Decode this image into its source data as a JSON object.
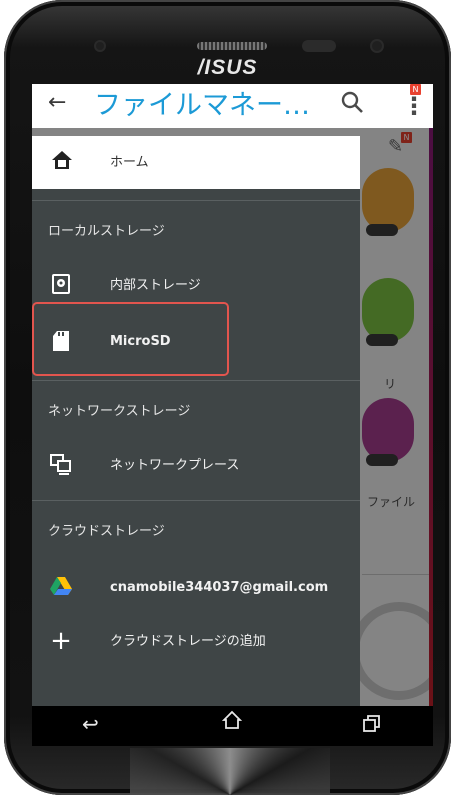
{
  "device": {
    "brand": "/ISUS"
  },
  "appbar": {
    "title": "ファイルマネー…",
    "badge": "N"
  },
  "background": {
    "labels": [
      "リ",
      "ファイル"
    ]
  },
  "drawer": {
    "home_label": "ホーム",
    "sections": [
      {
        "title": "ローカルストレージ"
      },
      {
        "title": "ネットワークストレージ"
      },
      {
        "title": "クラウドストレージ"
      }
    ],
    "items": [
      {
        "label": "内部ストレージ",
        "icon": "internal-storage-icon"
      },
      {
        "label": "MicroSD",
        "icon": "sd-card-icon",
        "highlighted": true
      },
      {
        "label": "ネットワークプレース",
        "icon": "network-place-icon"
      },
      {
        "label": "cnamobile344037@gmail.com",
        "icon": "google-drive-icon"
      },
      {
        "label": "クラウドストレージの追加",
        "icon": "plus-icon"
      }
    ]
  },
  "colors": {
    "title_blue": "#1c9ad6",
    "drawer_bg": "#3f4546",
    "highlight_border": "#e2554e",
    "badge_red": "#e8412f"
  }
}
